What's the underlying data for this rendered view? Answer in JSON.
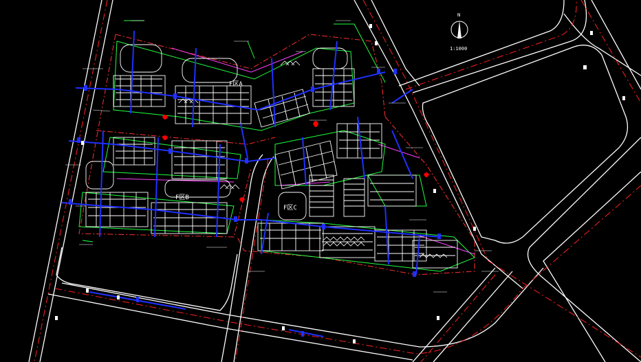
{
  "drawing": {
    "north_label": "N",
    "scale_label": "1:1000",
    "zone_labels": [
      "F区A",
      "F区B",
      "F区C"
    ],
    "colors": {
      "background": "#000000",
      "road": "#ffffff",
      "centerline": "#ff2020",
      "boundary": "#ff3030",
      "pipe": "#2030ff",
      "building": "#ffffff",
      "landscape": "#20ff40",
      "accent": "#ff40ff",
      "marker": "#ff0000"
    }
  }
}
